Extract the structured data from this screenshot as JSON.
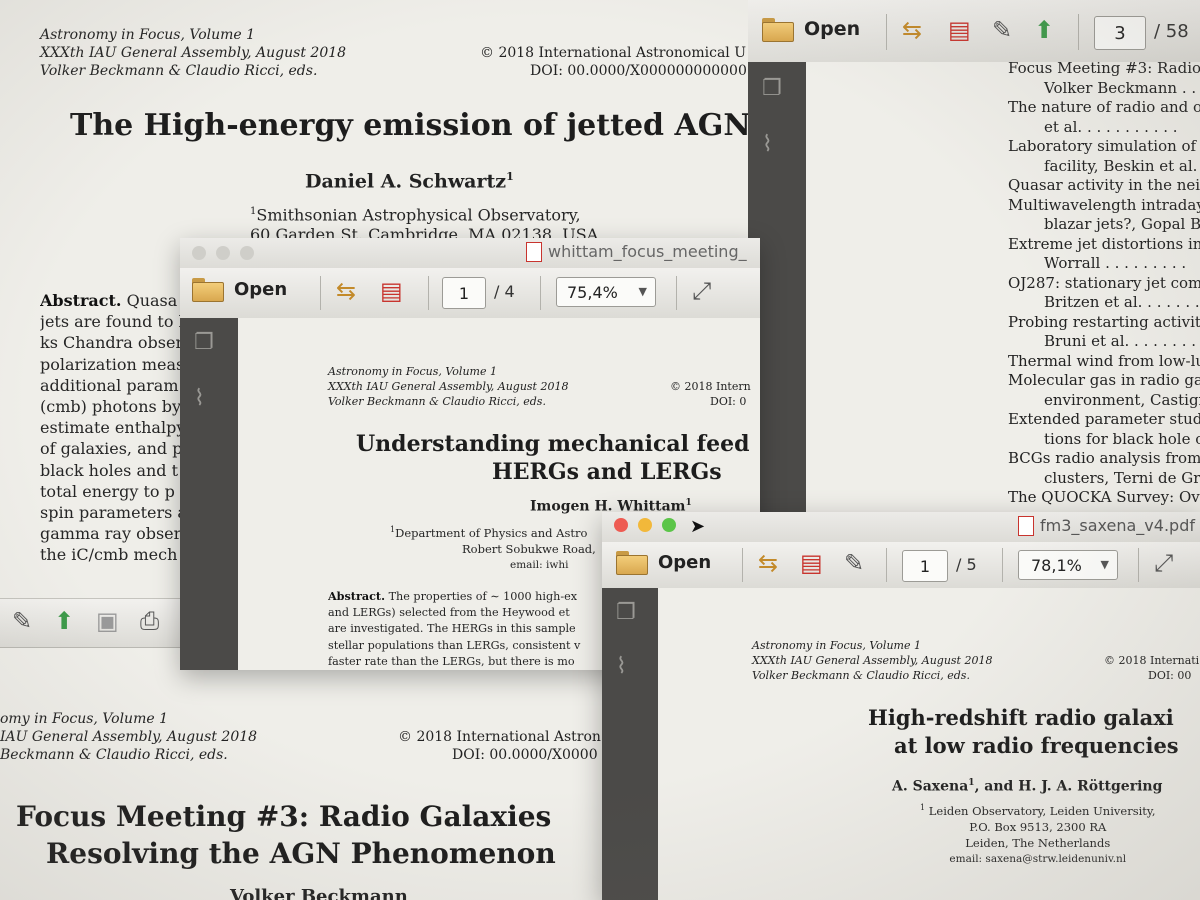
{
  "back_doc": {
    "header": [
      "Astronomy in Focus, Volume 1",
      "XXXth IAU General Assembly, August 2018",
      "Volker Beckmann & Claudio Ricci, eds."
    ],
    "copyright": "© 2018 International Astronomical U",
    "doi": "DOI: 00.0000/X000000000000",
    "title": "The High-energy emission of jetted AGN",
    "author": "Daniel A. Schwartz",
    "author_sup": "1",
    "affil_sup": "1",
    "affiliation": [
      "Smithsonian Astrophysical Observatory,",
      "60 Garden St.,Cambridge, MA 02138, USA"
    ],
    "abstract_label": "Abstract.",
    "abstract_first": "Quasa",
    "abstract_lines": [
      "jets are found to h",
      "ks Chandra obser",
      "polarization meas",
      "additional param",
      "(cmb) photons by",
      "estimate enthalpy",
      "of galaxies, and p",
      "black holes and t",
      "total energy to p",
      "spin parameters a",
      "gamma ray obser",
      "the iC/cmb mech"
    ]
  },
  "bottom_doc": {
    "header": [
      "omy in Focus, Volume 1",
      "IAU General Assembly, August 2018",
      "Beckmann & Claudio Ricci, eds."
    ],
    "copyright": "© 2018 International Astron",
    "doi": "DOI: 00.0000/X0000",
    "title": [
      "Focus Meeting #3: Radio Galaxies",
      "Resolving the AGN Phenomenon"
    ],
    "author_fragment": "Volker Beckmann"
  },
  "toc_window": {
    "page_current": "3",
    "page_total": "/ 58",
    "open_label": "Open",
    "entries": [
      "Focus Meeting #3: Radio G",
      "Volker Beckmann . . . .",
      "The nature of radio and op",
      "et al. . . . . . . . . . .",
      "Laboratory simulation of a",
      "facility, Beskin et al. .",
      "Quasar activity in the neigh",
      "Multiwavelength intraday va",
      "blazar jets?, Gopal Bha",
      "Extreme jet distortions in",
      "Worrall . . . . . . . . .",
      "OJ287: stationary jet com",
      "Britzen et al. . . . . . .",
      "Probing restarting activity",
      "Bruni et al. . . . . . . .",
      "Thermal wind from low-lum",
      "Molecular gas in radio gal",
      "environment, Castigna",
      "Extended parameter study",
      "tions for black hole ou",
      "BCGs radio analysis from",
      "clusters, Terni de Greg",
      "The QUOCKA Survey: Ov"
    ]
  },
  "whittam_window": {
    "filename": "whittam_focus_meeting_",
    "open_label": "Open",
    "page_current": "1",
    "page_total": "/ 4",
    "zoom": "75,4%",
    "header": [
      "Astronomy in Focus, Volume 1",
      "XXXth IAU General Assembly, August 2018",
      "Volker Beckmann & Claudio Ricci, eds."
    ],
    "copyright": "© 2018 Intern",
    "doi": "DOI: 0",
    "title": [
      "Understanding mechanical feed",
      "HERGs and LERGs"
    ],
    "author": "Imogen H. Whittam",
    "author_sup": "1",
    "affil_sup": "1",
    "affiliation": [
      "Department of Physics and Astro",
      "Robert Sobukwe Road,",
      "email: iwhi"
    ],
    "abstract_label": "Abstract.",
    "abstract_first": "The properties of ∼ 1000 high-ex",
    "abstract_lines": [
      "and LERGs) selected from the Heywood et",
      "are investigated. The HERGs in this sample",
      "stellar populations than LERGs, consistent v",
      "faster rate than the LERGs, but there is mo"
    ]
  },
  "saxena_window": {
    "filename": "fm3_saxena_v4.pdf",
    "open_label": "Open",
    "page_current": "1",
    "page_total": "/ 5",
    "zoom": "78,1%",
    "header": [
      "Astronomy in Focus, Volume 1",
      "XXXth IAU General Assembly, August 2018",
      "Volker Beckmann & Claudio Ricci, eds."
    ],
    "copyright": "© 2018 Internati",
    "doi": "DOI: 00",
    "title": [
      "High-redshift radio galaxi",
      "at low radio frequencies"
    ],
    "authors": "A. Saxena",
    "authors_sup": "1",
    "authors_rest": ", and H. J. A. Röttgering",
    "affil_sup": "1",
    "affiliation": [
      "Leiden Observatory, Leiden University,",
      "P.O. Box 9513, 2300 RA",
      "Leiden, The Netherlands"
    ],
    "email": "email: saxena@strw.leidenuniv.nl"
  },
  "colors": {
    "sidebar": "#4b4a48",
    "traffic_red": "#ee5b52",
    "traffic_yellow": "#f2b83a",
    "traffic_green": "#5bc548",
    "pdf_icon": "#c8342e"
  }
}
